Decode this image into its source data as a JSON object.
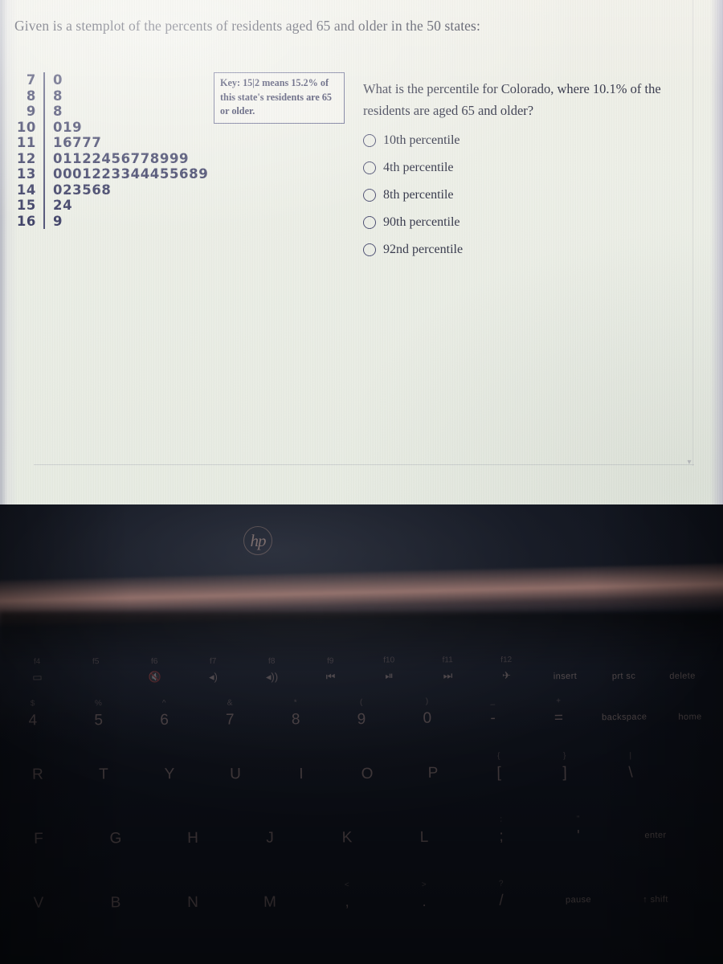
{
  "document": {
    "prompt": "Given is a stemplot of the percents of residents aged 65 and older in the 50 states:",
    "stemplot": {
      "rows": [
        {
          "stem": "7",
          "leaves": "0"
        },
        {
          "stem": "8",
          "leaves": "8"
        },
        {
          "stem": "9",
          "leaves": "8"
        },
        {
          "stem": "10",
          "leaves": "019"
        },
        {
          "stem": "11",
          "leaves": "16777"
        },
        {
          "stem": "12",
          "leaves": "01122456778999"
        },
        {
          "stem": "13",
          "leaves": "0001223344455689"
        },
        {
          "stem": "14",
          "leaves": "023568"
        },
        {
          "stem": "15",
          "leaves": "24"
        },
        {
          "stem": "16",
          "leaves": "9"
        }
      ]
    },
    "key_box": {
      "line1": "Key: 15|2 means 15.2% of",
      "line2": "this state's residents are 65",
      "line3": "or older."
    },
    "question": {
      "line1": "What is the percentile for Colorado, where 10.1% of the",
      "line2": "residents are aged 65 and older?",
      "choices": [
        {
          "label": "10th percentile"
        },
        {
          "label": "4th percentile"
        },
        {
          "label": "8th percentile"
        },
        {
          "label": "90th percentile"
        },
        {
          "label": "92nd percentile"
        }
      ]
    },
    "scroll_marker": "▾"
  },
  "laptop": {
    "brand_logo": "hp",
    "keyboard": {
      "function_row": [
        {
          "sup": "f4",
          "glyph": "▭"
        },
        {
          "sup": "f5",
          "glyph": ""
        },
        {
          "sup": "f6",
          "glyph": "🔇"
        },
        {
          "sup": "f7",
          "glyph": "◂)"
        },
        {
          "sup": "f8",
          "glyph": "◂))"
        },
        {
          "sup": "f9",
          "glyph": "⏮"
        },
        {
          "sup": "f10",
          "glyph": "⏯"
        },
        {
          "sup": "f11",
          "glyph": "⏭"
        },
        {
          "sup": "f12",
          "glyph": "✈"
        },
        {
          "sup": "",
          "word": "insert"
        },
        {
          "sup": "",
          "word": "prt sc"
        },
        {
          "sup": "",
          "word": "delete"
        }
      ],
      "number_row": [
        {
          "sup": "$",
          "main": "4"
        },
        {
          "sup": "%",
          "main": "5"
        },
        {
          "sup": "^",
          "main": "6"
        },
        {
          "sup": "&",
          "main": "7"
        },
        {
          "sup": "*",
          "main": "8"
        },
        {
          "sup": "(",
          "main": "9"
        },
        {
          "sup": ")",
          "main": "0"
        },
        {
          "sup": "_",
          "main": "-"
        },
        {
          "sup": "+",
          "main": "="
        },
        {
          "sup": "",
          "word": "backspace"
        },
        {
          "sup": "",
          "word": "home"
        }
      ],
      "top_letter_row": [
        {
          "main": "R"
        },
        {
          "main": "T"
        },
        {
          "main": "Y"
        },
        {
          "main": "U"
        },
        {
          "main": "I"
        },
        {
          "main": "O"
        },
        {
          "main": "P"
        },
        {
          "sup": "{",
          "main": "["
        },
        {
          "sup": "}",
          "main": "]"
        },
        {
          "sup": "|",
          "main": "\\"
        }
      ],
      "home_letter_row": [
        {
          "main": "F"
        },
        {
          "main": "G"
        },
        {
          "main": "H"
        },
        {
          "main": "J"
        },
        {
          "main": "K"
        },
        {
          "main": "L"
        },
        {
          "sup": ":",
          "main": ";"
        },
        {
          "sup": "\"",
          "main": "'"
        },
        {
          "sup": "",
          "word": "enter"
        }
      ],
      "bottom_letter_row": [
        {
          "main": "V"
        },
        {
          "main": "B"
        },
        {
          "main": "N"
        },
        {
          "main": "M"
        },
        {
          "sup": "<",
          "main": ","
        },
        {
          "sup": ">",
          "main": "."
        },
        {
          "sup": "?",
          "main": "/"
        },
        {
          "sup": "",
          "word": "pause"
        },
        {
          "sup": "",
          "word": "↑ shift"
        }
      ]
    }
  },
  "colors": {
    "screen_background": "#eceee6",
    "ink": "#2f3145",
    "stemplot_ink": "#3a3c63",
    "keybox_border": "#6b6d92",
    "radio_border": "#4a4c70",
    "laptop_body": "#0b0e16",
    "hinge_highlight": "#b08278"
  }
}
